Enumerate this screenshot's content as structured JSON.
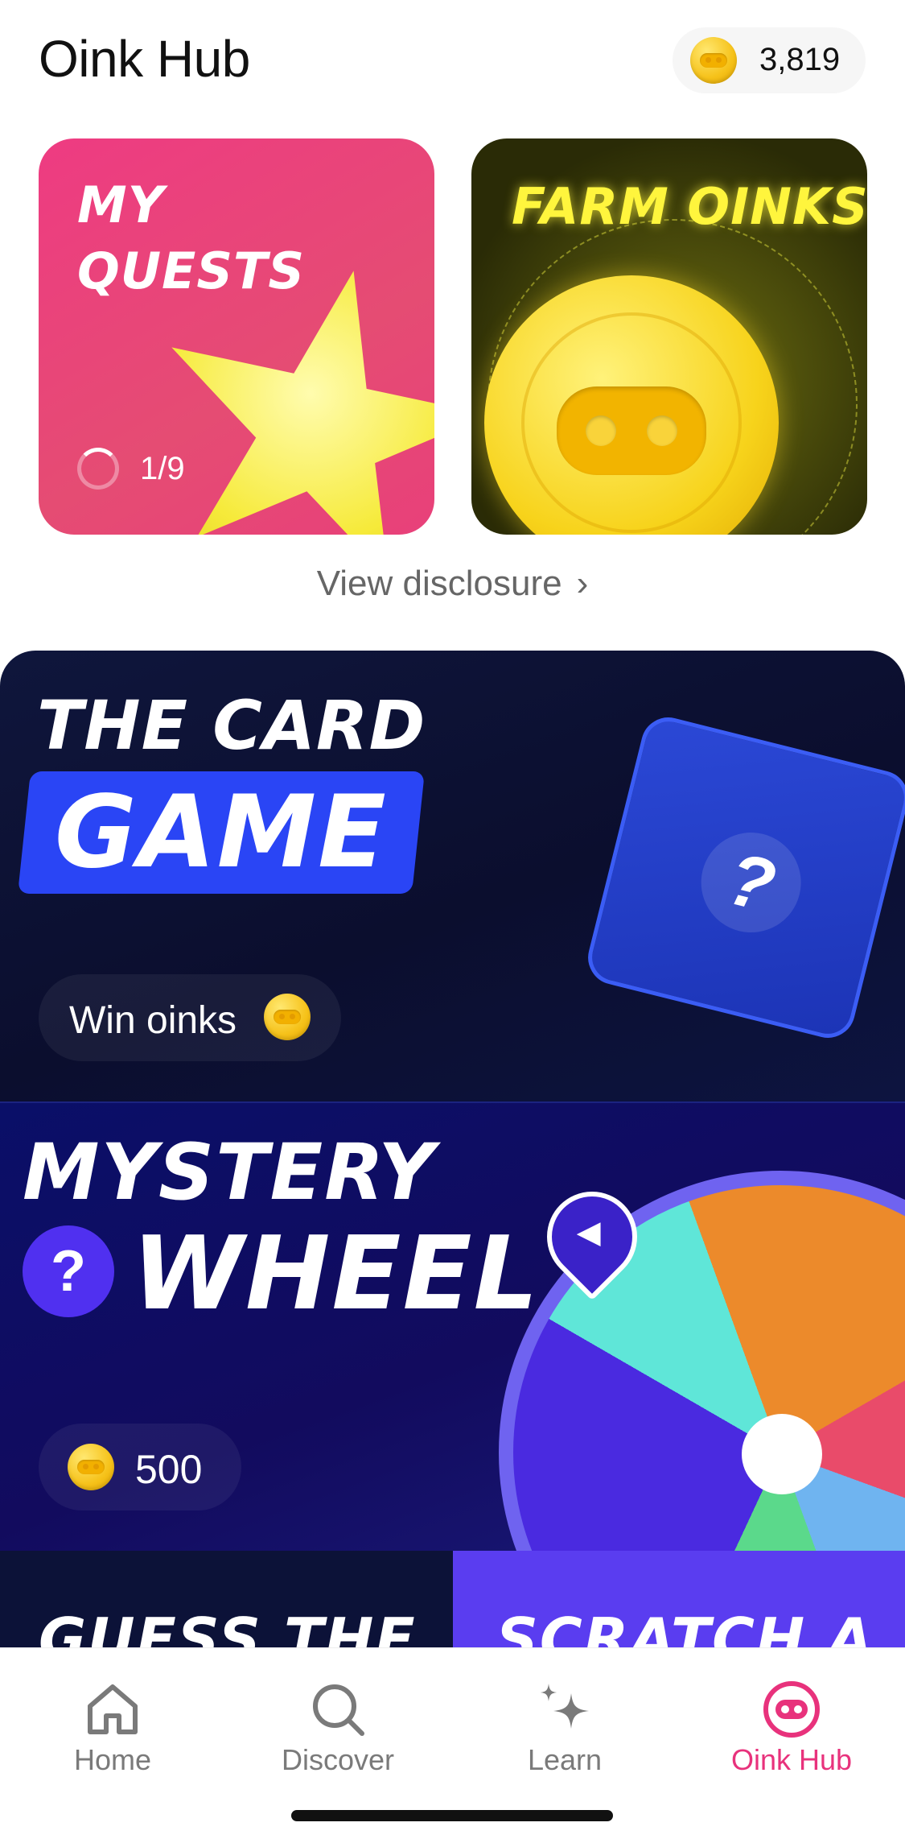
{
  "header": {
    "title": "Oink Hub",
    "balance": "3,819"
  },
  "tiles": [
    {
      "label_line1": "MY",
      "label_line2": "QUESTS",
      "progress": "1/9"
    },
    {
      "label": "FARM OINKS"
    }
  ],
  "disclosure_link": "View disclosure",
  "card_game": {
    "title_line1": "THE CARD",
    "title_line2": "GAME",
    "card_symbol": "?",
    "cta": "Win oinks"
  },
  "mystery_wheel": {
    "title_line1": "MYSTERY",
    "badge_symbol": "?",
    "title_line2": "WHEEL",
    "cost": "500"
  },
  "peek_tiles": [
    {
      "label": "GUESS THE"
    },
    {
      "label": "SCRATCH A"
    }
  ],
  "tabs": [
    {
      "label": "Home",
      "icon": "home-icon"
    },
    {
      "label": "Discover",
      "icon": "search-icon"
    },
    {
      "label": "Learn",
      "icon": "sparkle-icon"
    },
    {
      "label": "Oink Hub",
      "icon": "pig-snout-icon",
      "active": true
    }
  ],
  "colors": {
    "accent": "#e8327c",
    "coin": "#f6c21a",
    "quests_tile": "#ee3b82",
    "card_game_bg": "#0f163c",
    "wheel_bg": "#0a0f68"
  }
}
